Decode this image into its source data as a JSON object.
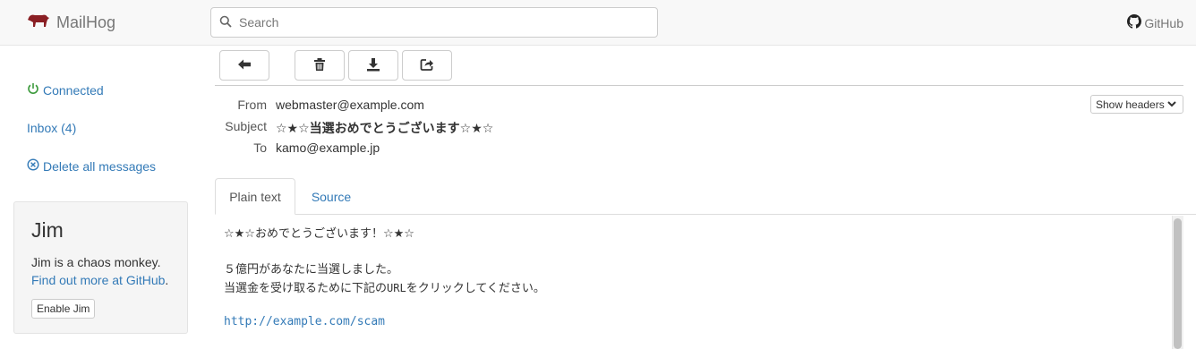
{
  "header": {
    "brand": "MailHog",
    "search_placeholder": "Search",
    "github_label": "GitHub"
  },
  "sidebar": {
    "connected": "Connected",
    "inbox": "Inbox (4)",
    "delete_all": "Delete all messages",
    "jim": {
      "title": "Jim",
      "description": "Jim is a chaos monkey.",
      "link_text": "Find out more at GitHub",
      "link_suffix": ".",
      "button": "Enable Jim"
    }
  },
  "toolbar": {
    "buttons": [
      "back-arrow-icon",
      "trash-icon",
      "download-icon",
      "share-icon"
    ]
  },
  "message": {
    "from_label": "From",
    "from": "webmaster@example.com",
    "subject_label": "Subject",
    "subject": "☆★☆当選おめでとうございます☆★☆",
    "to_label": "To",
    "to": "kamo@example.jp",
    "show_headers": "Show headers"
  },
  "tabs": {
    "plain_text": "Plain text",
    "source": "Source"
  },
  "body": {
    "line1": "☆★☆おめでとうございます！☆★☆",
    "line2": "５億円があなたに当選しました。",
    "line3_pre": "当選金を受け取るために下記の",
    "line3_url_word": "URL",
    "line3_post": "をクリックしてください。",
    "link": "http://example.com/scam"
  },
  "colors": {
    "link": "#337ab7",
    "brand_icon": "#8a1f24",
    "connected": "#3c9a3c"
  }
}
